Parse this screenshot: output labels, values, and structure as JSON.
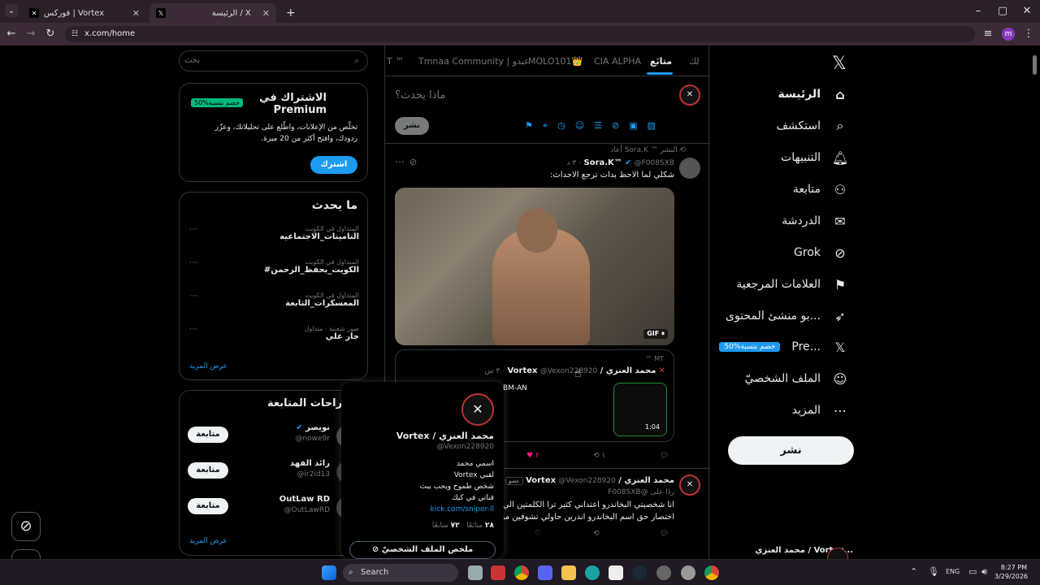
{
  "browser": {
    "tab1_title": "فوركس | Vortex",
    "tab2_title": "الرئيسة / X",
    "url": "x.com/home",
    "profile_initial": "m"
  },
  "nav": {
    "items": [
      "الرئيسة",
      "استكشف",
      "التنبيهات",
      "متابعة",
      "الدردشة",
      "Grok",
      "العلامات المرجعية",
      "بو منشئ المحتوى...",
      "Pre...",
      "الملف الشخصيّ",
      "المزيد"
    ],
    "premium_badge": "50%خصم بنسبة",
    "post_button": "نشر",
    "account_name": "محمد العنزي / Vortex..."
  },
  "tabs": [
    "لك",
    "متابَع",
    "CIA ALPHA",
    "MOLO101👑",
    "Tmnaa Community | عبدو",
    "T ™"
  ],
  "compose": {
    "placeholder": "ماذا يحدث؟",
    "post_button": "نشر"
  },
  "tweet1": {
    "retweeted_by": "أعاد Sora.K ™ النشر",
    "name": "Sora.K™",
    "handle": "@F008SXB",
    "time": "٣ د",
    "text": "شكلي لما الاحظ بدات ترجع الاحداث:",
    "gif_label": "GIF",
    "quote": {
      "community": "™ MT",
      "name": "محمد العنزي / Vortex",
      "handle": "@Vexon228920",
      "time": "٣ س",
      "snippet": "BM-AN",
      "duration": "1:04"
    },
    "likes": "٢",
    "retweets": "١"
  },
  "hover_card": {
    "name": "محمد العنزي / Vortex",
    "handle": "@Vexon228920",
    "bio_lines": [
      "اسمي محمد",
      "لقبي Vortex",
      "شخص طموح ويحب يبث",
      "قناتي في كيك"
    ],
    "link": "kick.com/sniper-ll",
    "following_count": "٧٢",
    "following_label": "متابعًا",
    "followers_count": "٢٨",
    "followers_label": "متابَعًا",
    "summary_button": "ملخص الملف الشخصيّ"
  },
  "tweet2": {
    "name": "محمد العنزي / Vortex",
    "handle": "@Vexon228920",
    "badge": "عضو",
    "reply_to": "ردًا على @F008SXB",
    "text1": "انا شخصيتي البخاندرو اعتداني كثير ترا الكلمتين الي",
    "text2": "اختصار حق اسم البخاندرو اندرين حاولي تشوفين مرا"
  },
  "sidebar": {
    "search_placeholder": "بحث",
    "premium_title": "الاشتراك في Premium",
    "premium_badge": "50%خصم بنسبة",
    "premium_text1": "تخلّص من الإعلانات، واطّلع على تحليلاتك، وعزّز",
    "premium_text2": "ردودك، وافتح أكثر من 20 ميزة.",
    "premium_button": "اشترك",
    "trends_title": "ما يحدث",
    "trends": [
      {
        "cat": "المتداول في الكويت",
        "name": "التامينات_الاجتماعيه"
      },
      {
        "cat": "المتداول في الكويت",
        "name": "#الكويت_بحفظ_الرحمن"
      },
      {
        "cat": "المتداول في الكويت",
        "name": "المعسكرات_التابعة"
      },
      {
        "cat": "صور شعبية · متداول",
        "name": "جار علي"
      }
    ],
    "show_more": "عرض المزيد",
    "follow_title": "اقتراحات المتابعة",
    "follow": [
      {
        "name": "نويصر",
        "handle": "@nowe9r",
        "btn": "متابعة"
      },
      {
        "name": "رائد الفهد",
        "handle": "@ir2id13",
        "btn": "متابعة"
      },
      {
        "name": "OutLaw RD",
        "handle": "@OutLawRD",
        "btn": "متابعة"
      }
    ],
    "follow_more": "عرض المزيد"
  },
  "taskbar": {
    "search": "Search",
    "lang": "ENG",
    "time": "8:27 PM",
    "date": "3/29/2026"
  }
}
